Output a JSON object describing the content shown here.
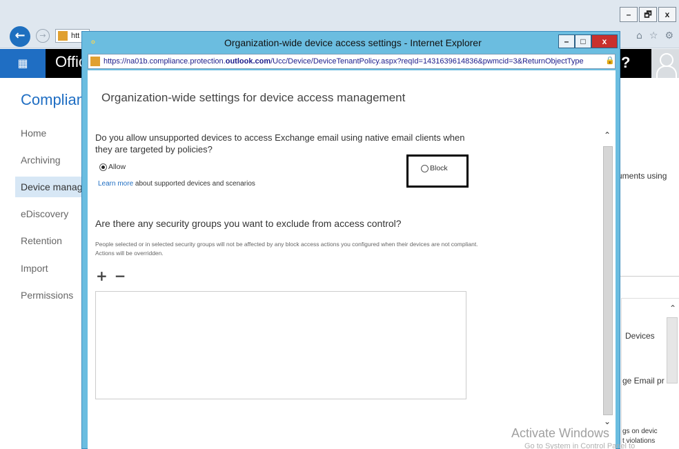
{
  "background_browser": {
    "window_buttons": [
      "–",
      "🗗",
      "x"
    ],
    "address_text": "htt",
    "toolbar_icons": [
      "home-icon",
      "star-icon",
      "gear-icon"
    ],
    "app_brand": "Offic",
    "help_label": "?",
    "section_title": "Complian",
    "nav_items": [
      "Home",
      "Archiving",
      "Device manag",
      "eDiscovery",
      "Retention",
      "Import",
      "Permissions"
    ],
    "active_nav": "Device manag",
    "right_snippets": {
      "uments": "uments using",
      "devices": "Devices",
      "manage": "ge Email pr",
      "settings": "gs on devic",
      "violations": "t violations"
    }
  },
  "popup": {
    "title": "Organization-wide device access settings - Internet Explorer",
    "buttons": {
      "minimize": "–",
      "maximize": "□",
      "close": "x"
    },
    "url_prefix": "https://na01b.compliance.protection.",
    "url_bold": "outlook.com",
    "url_suffix": "/Ucc/Device/DeviceTenantPolicy.aspx?reqId=1431639614836&pwmcid=3&ReturnObjectType",
    "heading": "Organization-wide settings for device access management",
    "question1": "Do you allow unsupported devices to access Exchange email using native email clients when they are targeted by policies?",
    "options": {
      "allow": {
        "label": "Allow",
        "selected": true
      },
      "block": {
        "label": "Block",
        "selected": false
      }
    },
    "learn_more_link": "Learn more",
    "learn_more_rest": " about supported devices and scenarios",
    "question2": "Are there any security groups you want to exclude from access control?",
    "question2_desc": "People selected or in selected security groups will not be affected by any block access actions you configured when their devices are not compliant. Actions will be overridden.",
    "add_label": "+",
    "remove_label": "−",
    "scroll_up": "^",
    "scroll_down": "v"
  },
  "watermark": {
    "line1": "Activate Windows",
    "line2": "Go to System in Control Panel to"
  }
}
